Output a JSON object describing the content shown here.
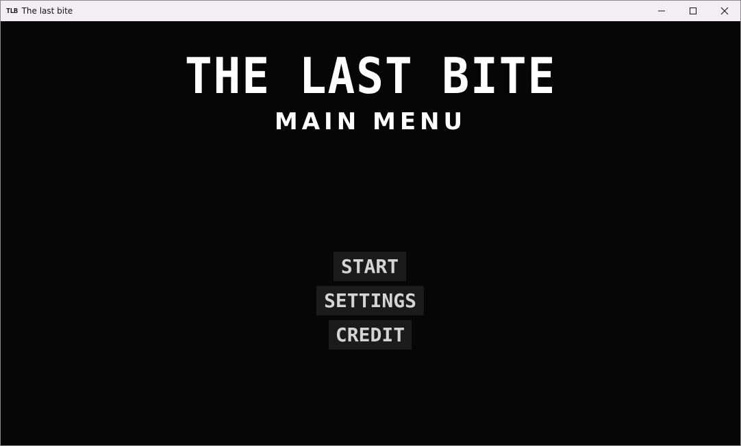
{
  "window": {
    "icon_text": "TLB",
    "title": "The last bite"
  },
  "controls": {
    "minimize_icon": "minimize-icon",
    "maximize_icon": "maximize-icon",
    "close_icon": "close-icon"
  },
  "game": {
    "title": "THE LAST BITE",
    "subtitle": "MAIN MENU"
  },
  "menu": {
    "start": "START",
    "settings": "SETTINGS",
    "credit": "CREDIT"
  },
  "colors": {
    "background": "#060606",
    "button_bg": "#1b1b1b",
    "button_text": "#d4d4d4",
    "title_text": "#ffffff"
  }
}
